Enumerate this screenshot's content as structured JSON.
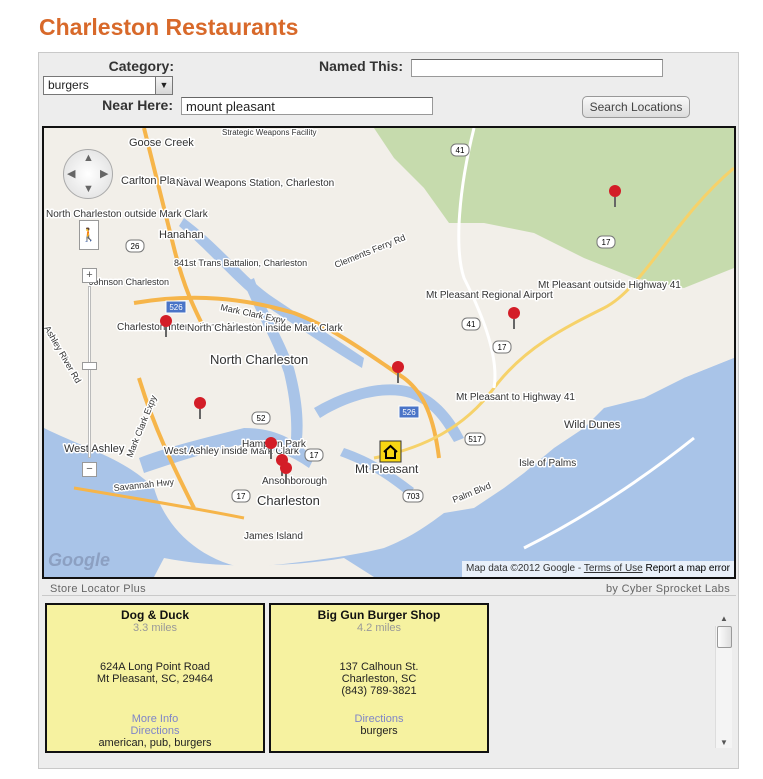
{
  "page": {
    "title": "Charleston Restaurants"
  },
  "search": {
    "category_label": "Category:",
    "category_value": "burgers",
    "named_label": "Named This:",
    "named_value": "",
    "near_label": "Near Here:",
    "near_value": "mount pleasant",
    "button_label": "Search Locations"
  },
  "map": {
    "labels": {
      "goose_creek": "Goose Creek",
      "strategic": "Strategic Weapons Facility",
      "carlton": "Carlton Place",
      "naval_station": "Naval Weapons Station, Charleston",
      "north_charleston_outside": "North Charleston outside Mark Clark",
      "hanahan": "Hanahan",
      "battalion": "841st Trans Battalion, Charleston",
      "johnson": "Johnson Charleston",
      "clements": "Clements Ferry Rd",
      "mark_clark_expy": "Mark Clark Expy",
      "mt_pleasant_airport": "Mt Pleasant Regional Airport",
      "mt_pleasant_outside": "Mt Pleasant outside Highway 41",
      "charleston_airport": "Charleston International Airport",
      "north_charleston_inside": "North Charleston inside Mark Clark",
      "north_charleston": "North Charleston",
      "ashley_river": "Ashley River Rd",
      "mark_clark_vertical": "Mark Clark Expy",
      "mt_pleasant_to_41": "Mt Pleasant to Highway 41",
      "wild_dunes": "Wild Dunes",
      "west_ashley": "West Ashley",
      "west_ashley_inside": "West Ashley inside Mark Clark",
      "hampton_park": "Hampton Park",
      "mt_pleasant": "Mt Pleasant",
      "isle_of_palms": "Isle of Palms",
      "ansonborough": "Ansonborough",
      "savannah_hwy": "Savannah Hwy",
      "charleston": "Charleston",
      "palm_blvd": "Palm Blvd",
      "james_island": "James Island"
    },
    "route_numbers": [
      "41",
      "17",
      "26",
      "526",
      "41",
      "17",
      "52",
      "526",
      "17",
      "517",
      "17",
      "703"
    ],
    "controls": {
      "pan_up": "▲",
      "pan_down": "▼",
      "pan_left": "◀",
      "pan_right": "▶",
      "pegman": "🚶",
      "zoom_in": "+",
      "zoom_out": "−"
    },
    "logo": "Google",
    "attribution": {
      "data": "Map data ©2012 Google -",
      "terms": "Terms of Use",
      "report": "Report a map error"
    },
    "marker_icon": "map-pin-icon",
    "home_icon": "home-icon",
    "colors": {
      "water": "#a9c4e8",
      "land": "#f2efe9",
      "park": "#c6dbad",
      "highway": "#f6b54a",
      "marker": "#d31d27"
    }
  },
  "credits": {
    "left": "Store Locator Plus",
    "right": "by Cyber Sprocket Labs"
  },
  "results": [
    {
      "name": "Dog & Duck",
      "distance": "3.3 miles",
      "address1": "624A Long Point Road",
      "address2": "Mt Pleasant, SC, 29464",
      "phone": "",
      "more_info": "More Info",
      "directions": "Directions",
      "tags": "american, pub, burgers"
    },
    {
      "name": "Big Gun Burger Shop",
      "distance": "4.2 miles",
      "address1": "137 Calhoun St.",
      "address2": "Charleston, SC",
      "phone": "(843) 789-3821",
      "directions": "Directions",
      "tags": "burgers"
    }
  ],
  "scrollbar": {
    "up": "▲",
    "down": "▼"
  }
}
